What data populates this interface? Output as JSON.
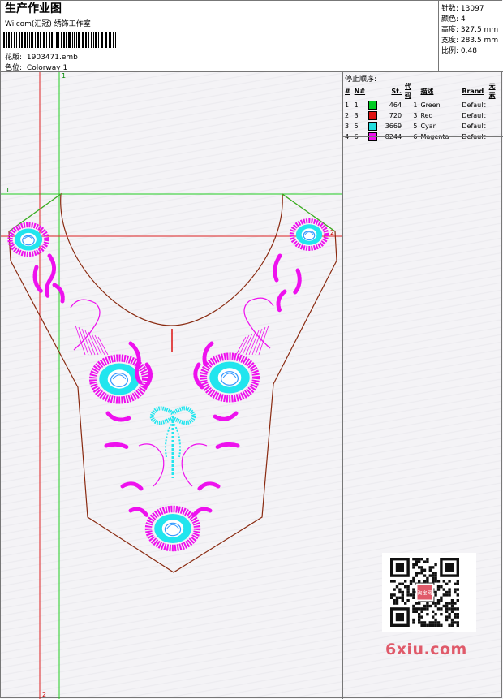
{
  "header": {
    "title": "生产作业图",
    "subtitle": "Wilcom(汇冠) 绣饰工作室",
    "file_label": "花版:",
    "file_value": "1903471.emb",
    "colorway_label": "色位:",
    "colorway_value": "Colorway 1"
  },
  "stats": [
    {
      "label": "针数:",
      "value": "13097"
    },
    {
      "label": "颜色:",
      "value": "4"
    },
    {
      "label": "高度:",
      "value": "327.5 mm"
    },
    {
      "label": "宽度:",
      "value": "283.5 mm"
    },
    {
      "label": "比例:",
      "value": "0.48"
    }
  ],
  "stop_sequence": {
    "heading": "停止顺序:",
    "columns": [
      "#",
      "N#",
      "St.",
      "代码",
      "描述",
      "Brand",
      "元素"
    ],
    "rows": [
      {
        "index": "1.",
        "n": "1",
        "stitches": "464",
        "code": "1",
        "desc": "Green",
        "brand": "Default",
        "color": "#00cc22"
      },
      {
        "index": "2.",
        "n": "3",
        "stitches": "720",
        "code": "3",
        "desc": "Red",
        "brand": "Default",
        "color": "#dd1111"
      },
      {
        "index": "3.",
        "n": "5",
        "stitches": "3669",
        "code": "5",
        "desc": "Cyan",
        "brand": "Default",
        "color": "#22dddd"
      },
      {
        "index": "4.",
        "n": "6",
        "stitches": "8244",
        "code": "6",
        "desc": "Magenta",
        "brand": "Default",
        "color": "#ee11ee"
      }
    ]
  },
  "guides": {
    "v1_label": "1",
    "h1_label": "1",
    "h2_label": "2",
    "v2_label": "2"
  },
  "watermark": {
    "text": "6xiu.com",
    "qr_stamp": "淘宝网"
  },
  "colors": {
    "green": "#00cc22",
    "red": "#dd1111",
    "cyan": "#22e5ee",
    "magenta": "#ee11ee",
    "outline": "#8a2a10"
  }
}
